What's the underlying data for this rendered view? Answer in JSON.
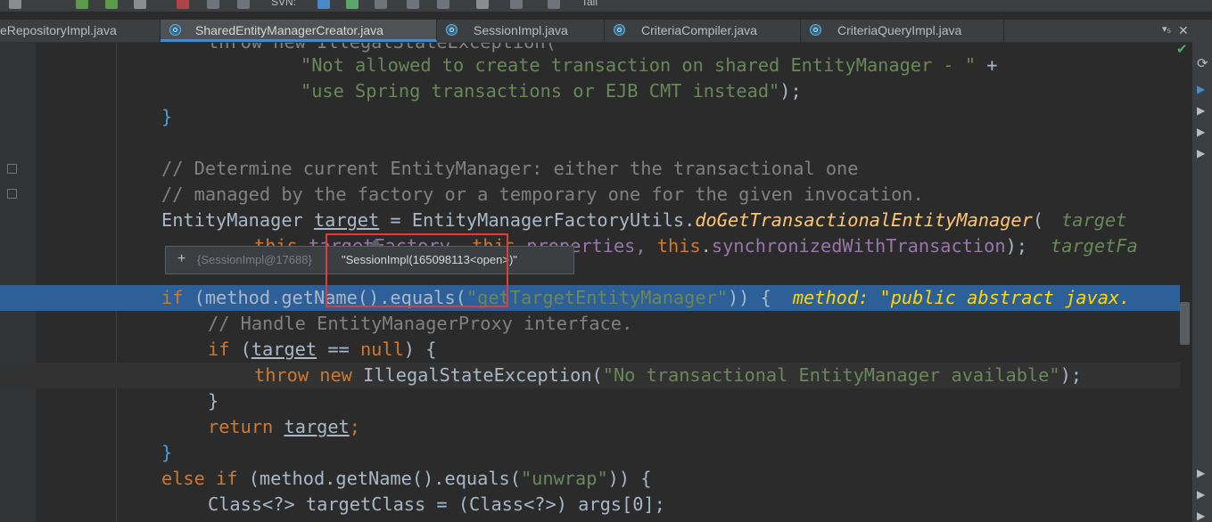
{
  "toolbar": {
    "svn_label": "SVN:",
    "tail_label": "Tail"
  },
  "tabs": [
    {
      "label": "eRepositoryImpl.java",
      "active": false
    },
    {
      "label": "SharedEntityManagerCreator.java",
      "active": true
    },
    {
      "label": "SessionImpl.java",
      "active": false
    },
    {
      "label": "CriteriaCompiler.java",
      "active": false
    },
    {
      "label": "CriteriaQueryImpl.java",
      "active": false
    }
  ],
  "tab_overflow": "▾₅",
  "tab_close": "✕",
  "code": {
    "l0": {
      "a": "throw new IllegalStateException("
    },
    "l1": {
      "a": "\"Not allowed to create transaction on shared EntityManager - \"",
      "b": " +"
    },
    "l2": {
      "a": "\"use Spring transactions or EJB CMT instead\"",
      "b": ");"
    },
    "l3": {
      "a": "}"
    },
    "l5": {
      "a": "// Determine current EntityManager: either the transactional one"
    },
    "l6": {
      "a": "// managed by the factory or a temporary one for the given invocation."
    },
    "l7": {
      "a": "EntityManager ",
      "b": "target",
      "c": " = EntityManagerFactoryUtils.",
      "d": "doGetTransactionalEntityManager",
      "e": "(",
      "hint": "target"
    },
    "l8": {
      "this1": "this",
      "a": ".targetFactory, ",
      "this2": "this",
      "b": ".properties, ",
      "this3": "this",
      "c": ".",
      "d": "synchronizedWithTransaction",
      "e": ");",
      "hint": "targetFa"
    },
    "l10": {
      "kw": "if",
      "a": " (method.getName().equals(",
      "s": "\"getTargetEntityManager\"",
      "b": ")) {",
      "hint": "method: \"public abstract javax."
    },
    "l11": {
      "a": "// Handle EntityManagerProxy interface."
    },
    "l12": {
      "kw": "if",
      "a": " (",
      "b": "target",
      "c": " == ",
      "n": "null",
      "d": ") {"
    },
    "l13": {
      "kw": "throw new",
      "a": " IllegalStateException(",
      "s": "\"No transactional EntityManager available\"",
      "b": ");"
    },
    "l14": {
      "a": "}"
    },
    "l15": {
      "kw": "return",
      "a": " ",
      "b": "target",
      "c": ";"
    },
    "l16": {
      "a": "}"
    },
    "l17": {
      "kw": "else if",
      "a": " (method.getName().equals(",
      "s": "\"unwrap\"",
      "b": ")) {"
    },
    "l18": {
      "a": "Class<?> targetClass = (Class<?>) args[0];"
    }
  },
  "tooltip": {
    "plus": "+",
    "object": "{SessionImpl@17688}",
    "value": "\"SessionImpl(165098113<open>)\""
  }
}
